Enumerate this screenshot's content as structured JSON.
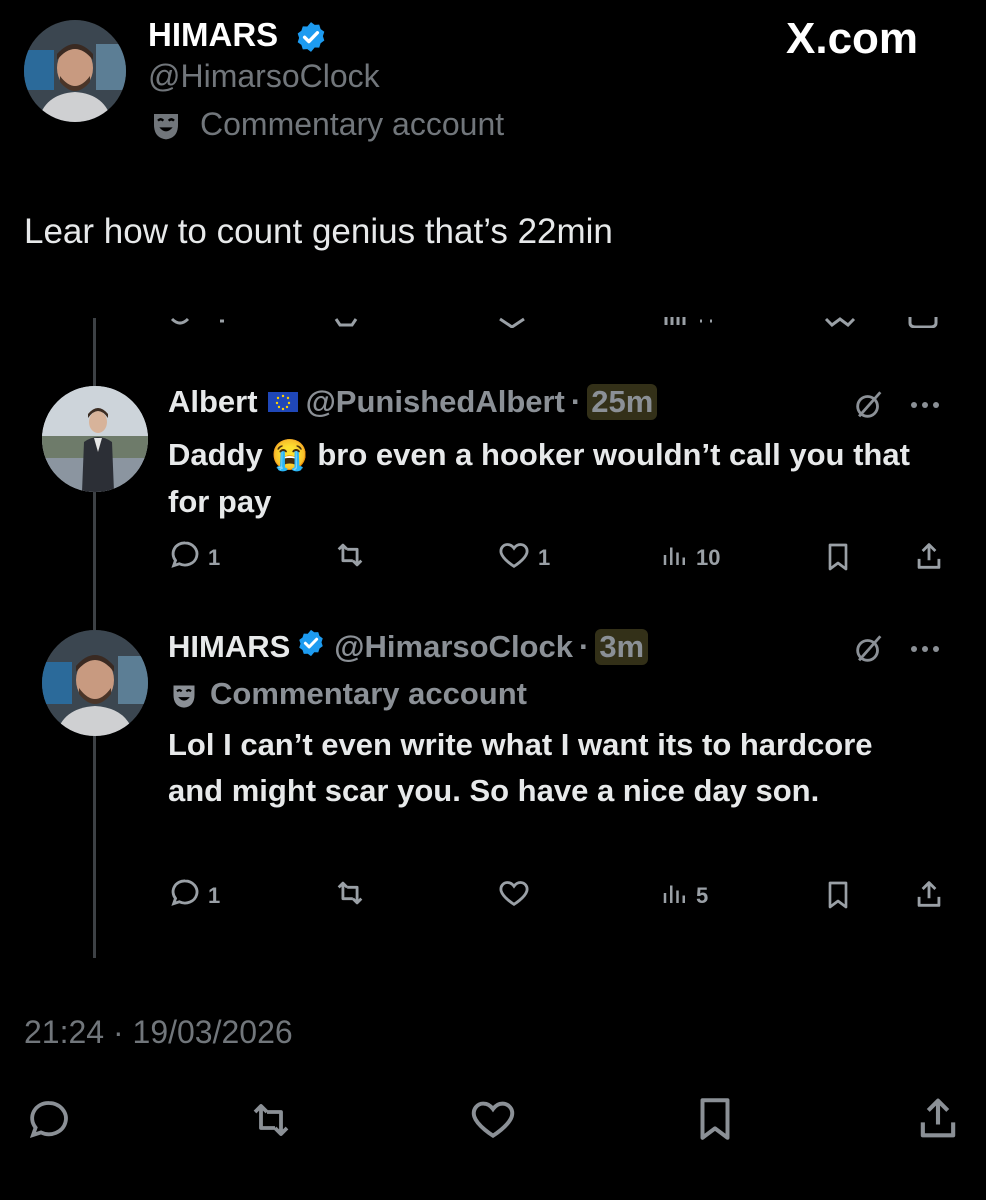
{
  "brand": {
    "watermark": "X.com"
  },
  "main_post": {
    "name": "HIMARS",
    "handle": "@HimarsoClock",
    "label": "Commentary account",
    "text": "Lear how to count genius that’s 22min",
    "timestamp": "21:24 · 19/03/2026"
  },
  "replies": [
    {
      "name": "Albert",
      "flag": "EU-flag-icon",
      "handle": "@PunishedAlbert",
      "sep": "·",
      "time": "25m",
      "text_before": "Daddy",
      "emoji": "😭",
      "text_after": "bro even a hooker wouldn’t call you that for pay",
      "stats": {
        "replies": "1",
        "reposts": "",
        "likes": "1",
        "views": "10"
      }
    },
    {
      "name": "HIMARS",
      "handle": "@HimarsoClock",
      "sep": "·",
      "time": "3m",
      "label": "Commentary account",
      "text": "Lol I can’t even write what I want its to hardcore and might scar you. So have a nice day son.",
      "stats": {
        "replies": "1",
        "reposts": "",
        "likes": "",
        "views": "5"
      }
    }
  ],
  "colors": {
    "background": "#000000",
    "text": "#e7e9ea",
    "muted": "#71767b",
    "verified": "#1d9bf0"
  },
  "icons": [
    "verified-badge-icon",
    "commentary-mask-icon",
    "reply-icon",
    "repost-icon",
    "like-icon",
    "views-icon",
    "bookmark-icon",
    "share-icon",
    "grok-icon",
    "more-icon"
  ]
}
